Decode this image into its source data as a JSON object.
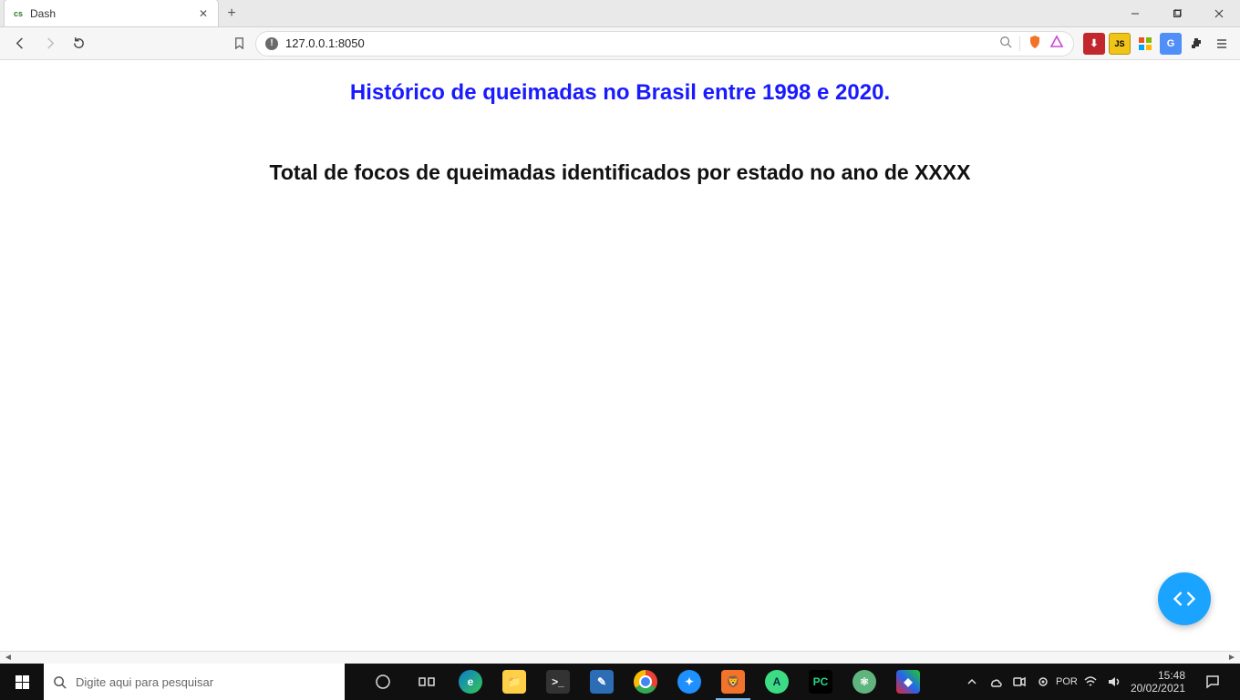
{
  "window": {
    "tab_title": "Dash"
  },
  "toolbar": {
    "url": "127.0.0.1:8050"
  },
  "page": {
    "title": "Histórico de queimadas no Brasil entre 1998 e 2020.",
    "subtitle": "Total de focos de queimadas identificados por estado no ano de XXXX"
  },
  "taskbar": {
    "search_placeholder": "Digite aqui para pesquisar",
    "clock_time": "15:48",
    "clock_date": "20/02/2021"
  }
}
